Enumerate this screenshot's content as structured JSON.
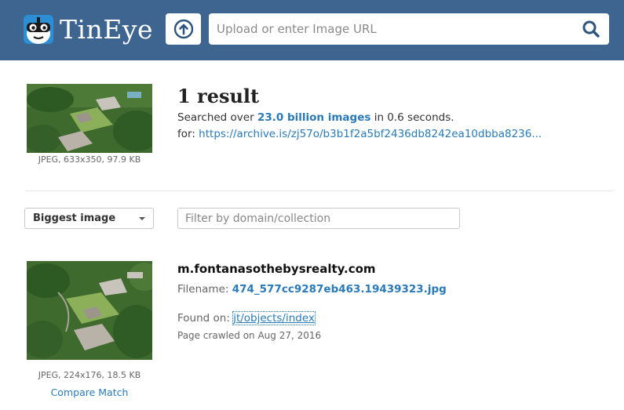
{
  "header": {
    "brand": "TinEye",
    "logo_icon": "tineye-robot-logo",
    "upload_icon": "upload-arrow-icon",
    "search_placeholder": "Upload or enter Image URL",
    "search_value": "",
    "search_icon": "magnifier-icon",
    "background_color": "#3e6490"
  },
  "query": {
    "image_meta": "JPEG, 633x350, 97.9 KB",
    "results_title": "1 result",
    "searched_prefix": "Searched over",
    "index_count": "23.0 billion images",
    "searched_suffix": "in 0.6 seconds.",
    "for_label": "for:",
    "for_url": "https://archive.is/zj57o/b3b1f2a5bf2436db8242ea10dbba8236..."
  },
  "controls": {
    "sort_selected": "Biggest image",
    "filter_placeholder": "Filter by domain/collection",
    "filter_value": ""
  },
  "match": {
    "image_meta": "JPEG, 224x176, 18.5 KB",
    "compare_label": "Compare Match",
    "domain": "m.fontanasothebysrealty.com",
    "filename_label": "Filename:",
    "filename": "474_577cc9287eb463.19439323.jpg",
    "found_label": "Found on:",
    "found_link": "jt/objects/index",
    "crawled": "Page crawled on Aug 27, 2016"
  },
  "colors": {
    "link": "#2a7ab8",
    "accent": "#2c8fd6"
  }
}
